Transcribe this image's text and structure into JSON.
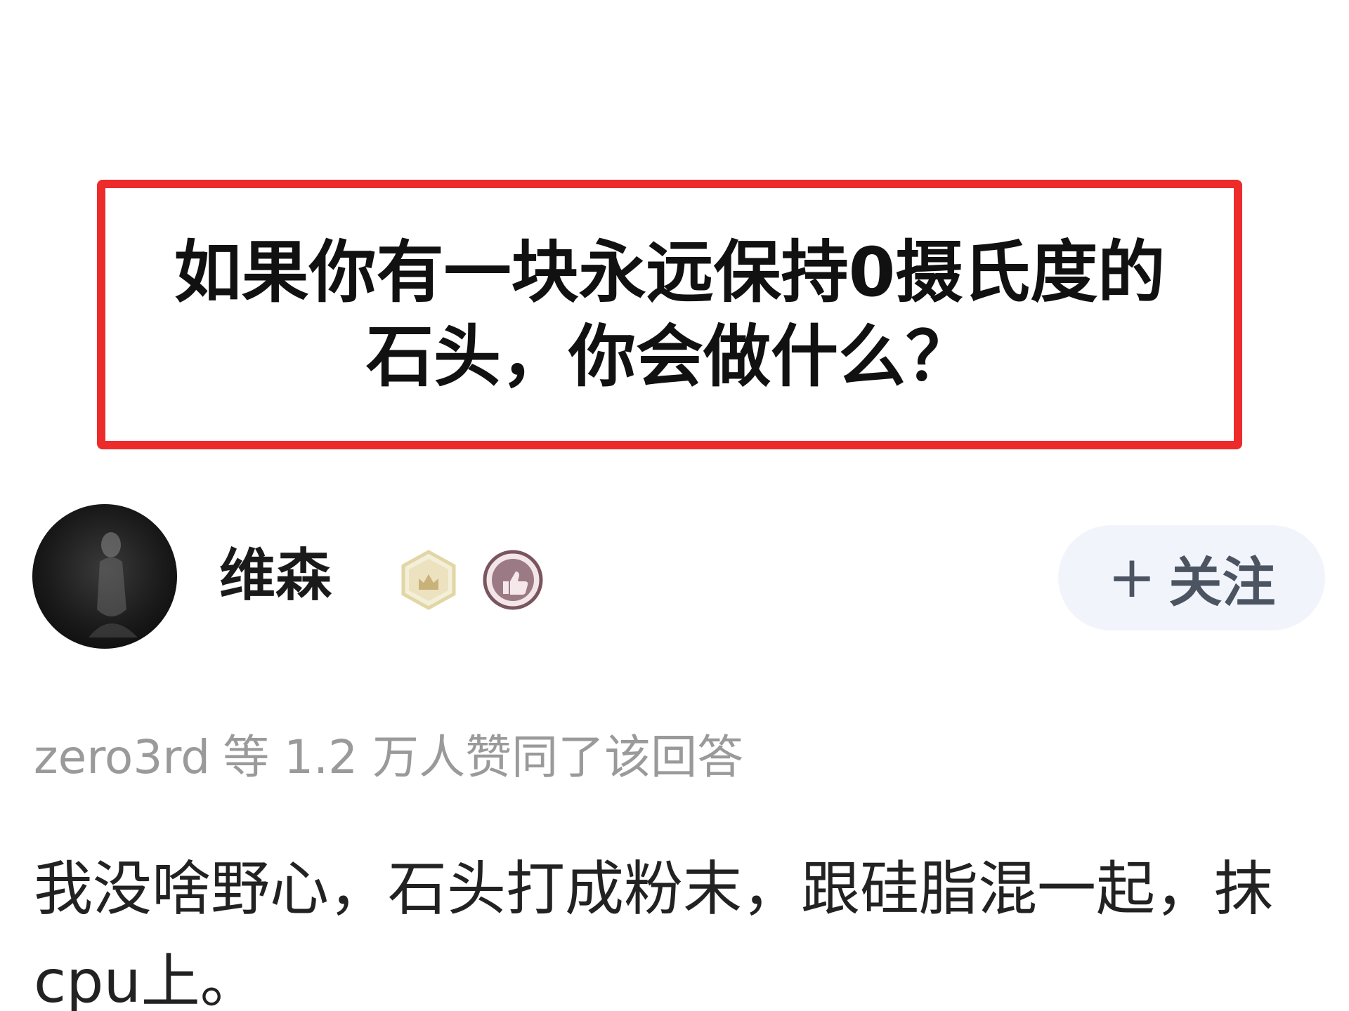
{
  "question": {
    "title": "如果你有一块永远保持0摄氏度的石头，你会做什么？"
  },
  "author": {
    "name": "维森",
    "follow_icon": "plus-icon",
    "follow_label": "关注"
  },
  "agree": {
    "user": "zero3rd",
    "text": "等 1.2 万人赞同了该回答"
  },
  "answer": {
    "text": "我没啥野心，石头打成粉末，跟硅脂混一起，抹cpu上。"
  },
  "colors": {
    "highlight_border": "#ee2b2b",
    "follow_bg": "#f1f5fb",
    "muted_text": "#9a9a9a"
  }
}
